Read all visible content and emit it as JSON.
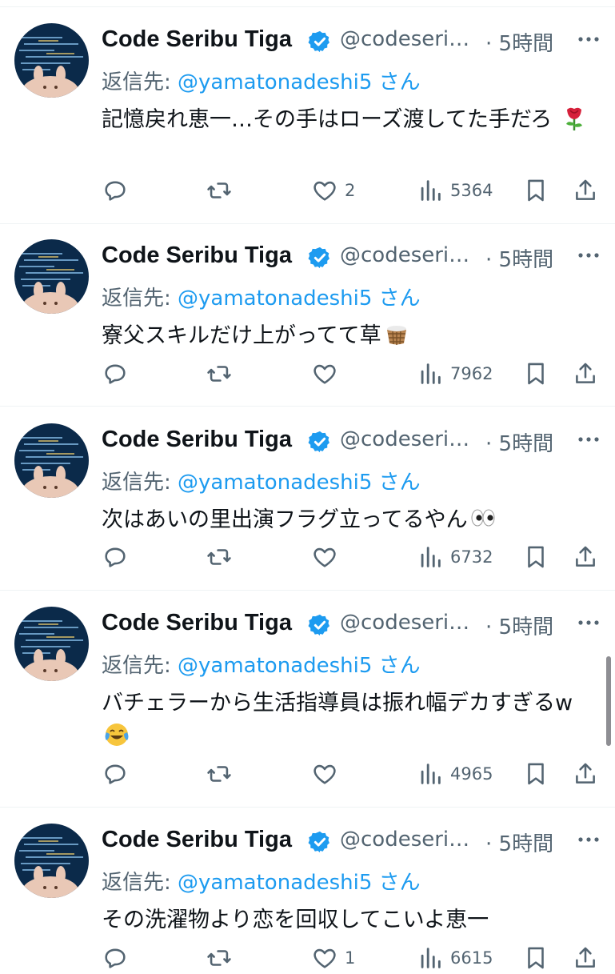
{
  "tweets": [
    {
      "name": "Code Seribu Tiga",
      "handle": "@codeseri…",
      "time": "· 5時間",
      "reply_label": "返信先: ",
      "reply_mention": "@yamatonadeshi5",
      "reply_suffix": " さん",
      "text": "記憶戻れ恵一…その手はローズ渡してた手だろ",
      "emoji": "rose",
      "likes": "2",
      "views": "5364"
    },
    {
      "name": "Code Seribu Tiga",
      "handle": "@codeseri…",
      "time": "· 5時間",
      "reply_label": "返信先: ",
      "reply_mention": "@yamatonadeshi5",
      "reply_suffix": " さん",
      "text": "寮父スキルだけ上がってて草",
      "emoji": "basket",
      "likes": "",
      "views": "7962"
    },
    {
      "name": "Code Seribu Tiga",
      "handle": "@codeseri…",
      "time": "· 5時間",
      "reply_label": "返信先: ",
      "reply_mention": "@yamatonadeshi5",
      "reply_suffix": " さん",
      "text": "次はあいの里出演フラグ立ってるやん",
      "emoji": "eyes",
      "likes": "",
      "views": "6732"
    },
    {
      "name": "Code Seribu Tiga",
      "handle": "@codeseri…",
      "time": "· 5時間",
      "reply_label": "返信先: ",
      "reply_mention": "@yamatonadeshi5",
      "reply_suffix": " さん",
      "text": "バチェラーから生活指導員は振れ幅デカすぎるw",
      "emoji": "joy",
      "likes": "",
      "views": "4965"
    },
    {
      "name": "Code Seribu Tiga",
      "handle": "@codeseri…",
      "time": "· 5時間",
      "reply_label": "返信先: ",
      "reply_mention": "@yamatonadeshi5",
      "reply_suffix": " さん",
      "text": "その洗濯物より恋を回収してこいよ恵一",
      "emoji": "",
      "likes": "1",
      "views": "6615"
    }
  ],
  "icons": {
    "reply": "reply-icon",
    "retweet": "retweet-icon",
    "like": "heart-icon",
    "views": "views-icon",
    "bookmark": "bookmark-icon",
    "share": "share-icon",
    "more": "more-icon",
    "verified": "verified-badge-icon"
  },
  "colors": {
    "text": "#0f1419",
    "secondary": "#536471",
    "link": "#1d9bf0",
    "divider": "#eff3f4"
  }
}
